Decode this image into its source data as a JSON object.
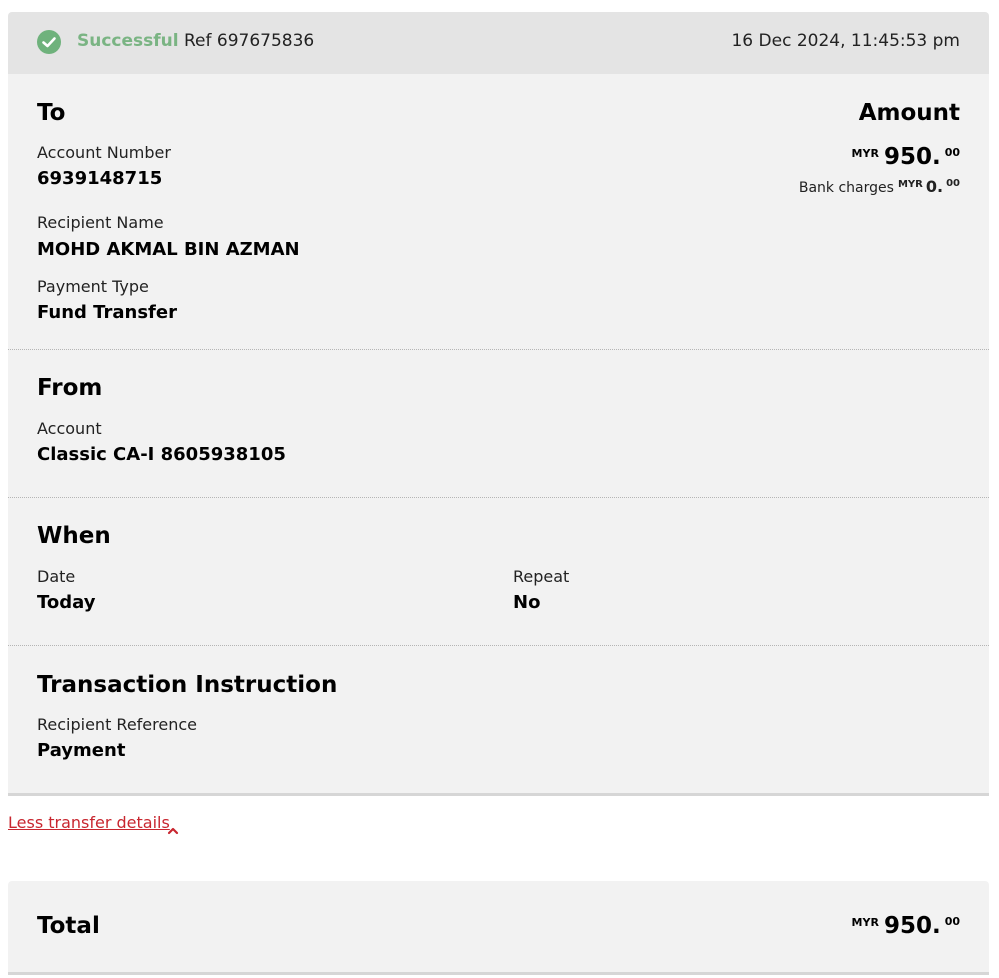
{
  "status": {
    "state": "Successful",
    "ref": "Ref 697675836",
    "timestamp": "16 Dec 2024, 11:45:53 pm",
    "icon": "check-circle-icon",
    "success_color": "#7ab483"
  },
  "to": {
    "heading": "To",
    "account_label": "Account Number",
    "account_value": "6939148715",
    "recipient_label": "Recipient Name",
    "recipient_value": "MOHD AKMAL BIN AZMAN",
    "payment_type_label": "Payment Type",
    "payment_type_value": "Fund Transfer"
  },
  "amount": {
    "heading": "Amount",
    "currency": "MYR",
    "whole": "950.",
    "cents": "00",
    "charges_label": "Bank charges",
    "charges_currency": "MYR",
    "charges_whole": "0.",
    "charges_cents": "00"
  },
  "from": {
    "heading": "From",
    "account_label": "Account",
    "account_value": "Classic CA-I 8605938105"
  },
  "when": {
    "heading": "When",
    "date_label": "Date",
    "date_value": "Today",
    "repeat_label": "Repeat",
    "repeat_value": "No"
  },
  "instruction": {
    "heading": "Transaction Instruction",
    "reference_label": "Recipient Reference",
    "reference_value": "Payment"
  },
  "toggle": {
    "label": "Less transfer details",
    "icon": "chevron-up-icon",
    "color": "#c8262f"
  },
  "total": {
    "label": "Total",
    "currency": "MYR",
    "whole": "950.",
    "cents": "00"
  }
}
